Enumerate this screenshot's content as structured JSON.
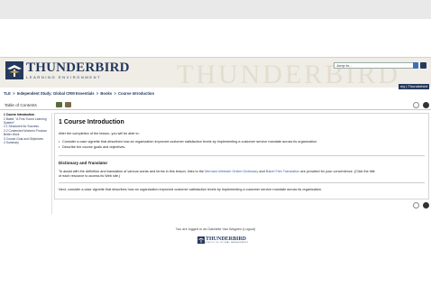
{
  "header": {
    "logo_name": "THUNDERBIRD",
    "logo_sub": "LEARNING ENVIRONMENT",
    "watermark": "THUNDERBIRD",
    "jump_placeholder": "Jump to...",
    "my_link": "my | Thunderbird"
  },
  "breadcrumb": {
    "items": [
      "TLE",
      "Independent Study: Global CRM Essentials",
      "Books",
      "Course Introduction"
    ],
    "separator": ">"
  },
  "toc": {
    "title": "Table of Contents",
    "items": [
      "1 Course Introduction",
      "2 Babel: \"A Fine-Tuned Learning System\"",
      "2.1 Structured for Success",
      "2.2 Contended Workers Produce Better Work",
      "3 Course Goal and Objectives",
      "4 Summary"
    ]
  },
  "content": {
    "title": "1 Course Introduction",
    "intro": "After the completion of the lesson, you will be able to:",
    "bullets": [
      "Consider a case vignette that describes how an organization improved customer satisfaction levels by implementing a customer service mandate across its organization.",
      "Describe the course goals and objectives."
    ],
    "section_title": "Dictionary and Translator",
    "dict_text_1": "To assist with the definition and translation of various words and terms in this lesson, links to the ",
    "dict_link_1": "Merriam-Webster Online Dictionary",
    "dict_text_2": " and ",
    "dict_link_2": "Babel Fish Translation",
    "dict_text_3": " are provided for your convenience. (Click the title",
    "dict_text_4": "of each resource to access its Web site.)",
    "next_text": "Next, consider a case vignette that describes how an organization improved customer satisfaction levels by implementing a customer service mandate across its organization."
  },
  "footer": {
    "logged_in": "You are logged in as Gabrielle Van Wagnen (Logout)",
    "logo_name": "THUNDERBIRD",
    "logo_sub": "SCHOOL OF GLOBAL MANAGEMENT"
  },
  "colors": {
    "brand": "#26395d",
    "link": "#3563a8",
    "banner": "#efede6"
  }
}
